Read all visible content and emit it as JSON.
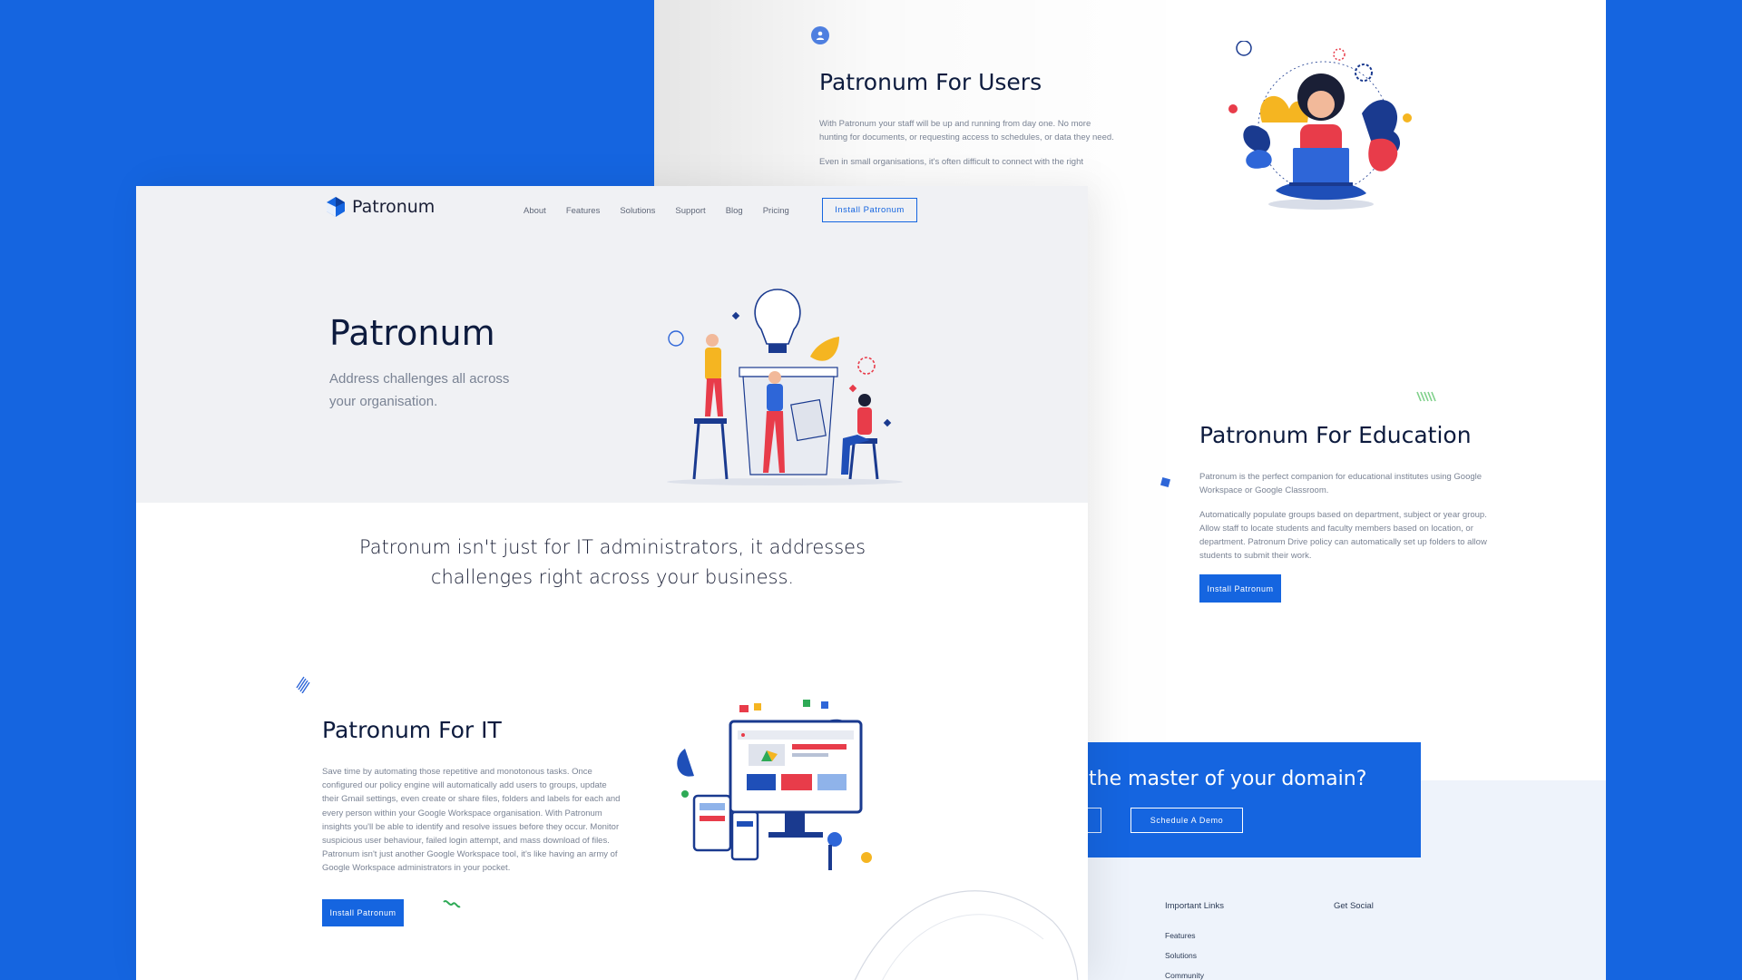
{
  "brand": {
    "name": "Patronum",
    "accent": "#1565e0",
    "background": "#1565e0"
  },
  "nav": {
    "items": [
      "About",
      "Features",
      "Solutions",
      "Support",
      "Blog",
      "Pricing"
    ],
    "install_label": "Install Patronum"
  },
  "hero": {
    "title": "Patronum",
    "subtitle": "Address challenges all across your organisation."
  },
  "tagline": "Patronum isn't just for IT administrators, it addresses challenges right across your business.",
  "it_section": {
    "title": "Patronum For IT",
    "body": "Save time by automating those repetitive and monotonous tasks. Once configured our policy engine will automatically add users to groups, update their Gmail settings, even create or share files, folders and labels for each and every person within your Google Workspace organisation. With Patronum insights you'll be able to identify and resolve issues before they occur. Monitor suspicious user behaviour, failed login attempt, and mass download of files. Patronum isn't just another Google Workspace tool, it's like having an army of Google Workspace administrators in your pocket.",
    "button_label": "Install Patronum"
  },
  "users_section": {
    "title": "Patronum For Users",
    "para1": "With Patronum your staff will be up and running from day one. No more hunting for documents, or requesting access to schedules, or data they need.",
    "para2": "Even in small organisations, it's often difficult to connect with the right"
  },
  "education_section": {
    "title": "Patronum For Education",
    "para1": "Patronum is the perfect companion for educational institutes using Google Workspace or Google Classroom.",
    "para2": "Automatically populate groups based on department, subject or year group. Allow staff to locate students and faculty members based on location, or department. Patronum Drive policy can automatically set up folders to allow students to submit their work.",
    "button_label": "Install Patronum"
  },
  "cta": {
    "text": "the master of your domain?",
    "button_label": "Schedule A Demo"
  },
  "footer": {
    "important_links_heading": "Important Links",
    "links": [
      "Features",
      "Solutions",
      "Community"
    ],
    "social_heading": "Get Social"
  }
}
